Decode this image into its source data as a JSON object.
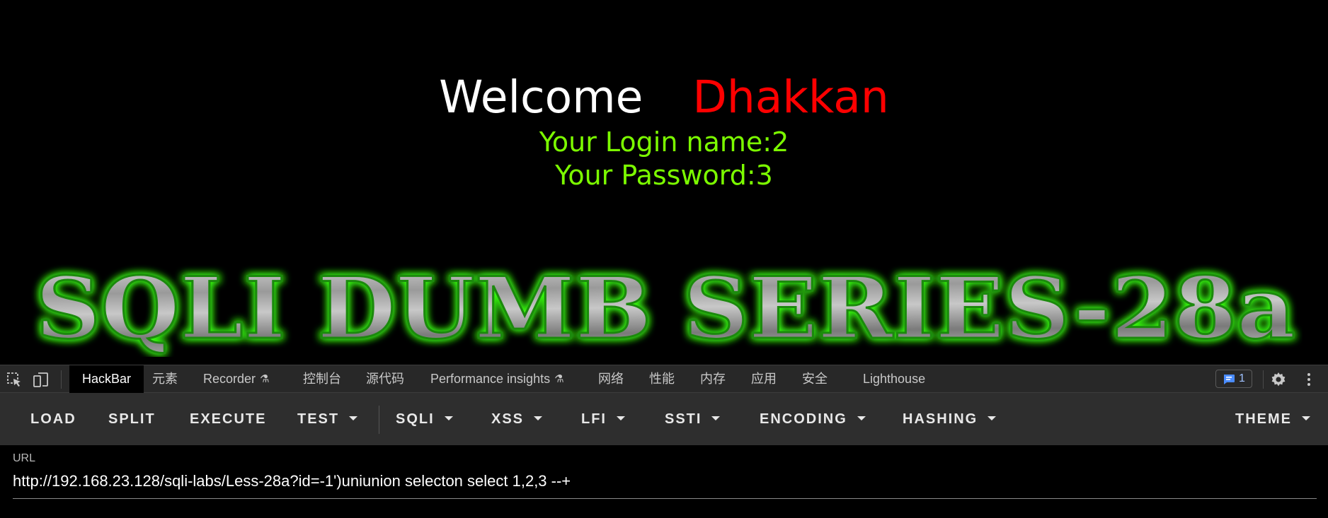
{
  "page": {
    "welcome_word": "Welcome",
    "user_name": "Dhakkan",
    "login_line": "Your Login name:2",
    "password_line": "Your Password:3",
    "banner_text": "SQLI DUMB SERIES-28a"
  },
  "devtools": {
    "tabs": [
      {
        "label": "HackBar",
        "active": true
      },
      {
        "label": "元素"
      },
      {
        "label": "Recorder",
        "flask": true
      },
      {
        "label": "控制台"
      },
      {
        "label": "源代码"
      },
      {
        "label": "Performance insights",
        "flask": true
      },
      {
        "label": "网络"
      },
      {
        "label": "性能"
      },
      {
        "label": "内存"
      },
      {
        "label": "应用"
      },
      {
        "label": "安全"
      },
      {
        "label": "Lighthouse"
      }
    ],
    "messages_count": "1",
    "icons": [
      "inspect-element-icon",
      "device-toolbar-icon",
      "message-icon",
      "gear-icon",
      "more-vert-icon"
    ]
  },
  "hackbar": {
    "buttons": [
      {
        "label": "LOAD"
      },
      {
        "label": "SPLIT"
      },
      {
        "label": "EXECUTE"
      },
      {
        "label": "TEST",
        "dropdown": true
      },
      {
        "label": "SQLI",
        "dropdown": true
      },
      {
        "label": "XSS",
        "dropdown": true
      },
      {
        "label": "LFI",
        "dropdown": true
      },
      {
        "label": "SSTI",
        "dropdown": true
      },
      {
        "label": "ENCODING",
        "dropdown": true
      },
      {
        "label": "HASHING",
        "dropdown": true
      },
      {
        "label": "THEME",
        "dropdown": true
      }
    ],
    "url_label": "URL",
    "url_value": "http://192.168.23.128/sqli-labs/Less-28a?id=-1')uniunion selecton select 1,2,3 --+"
  },
  "colors": {
    "user_name": "#ff0000",
    "info_text": "#7cfc00",
    "banner_glow": "#39ff14"
  }
}
